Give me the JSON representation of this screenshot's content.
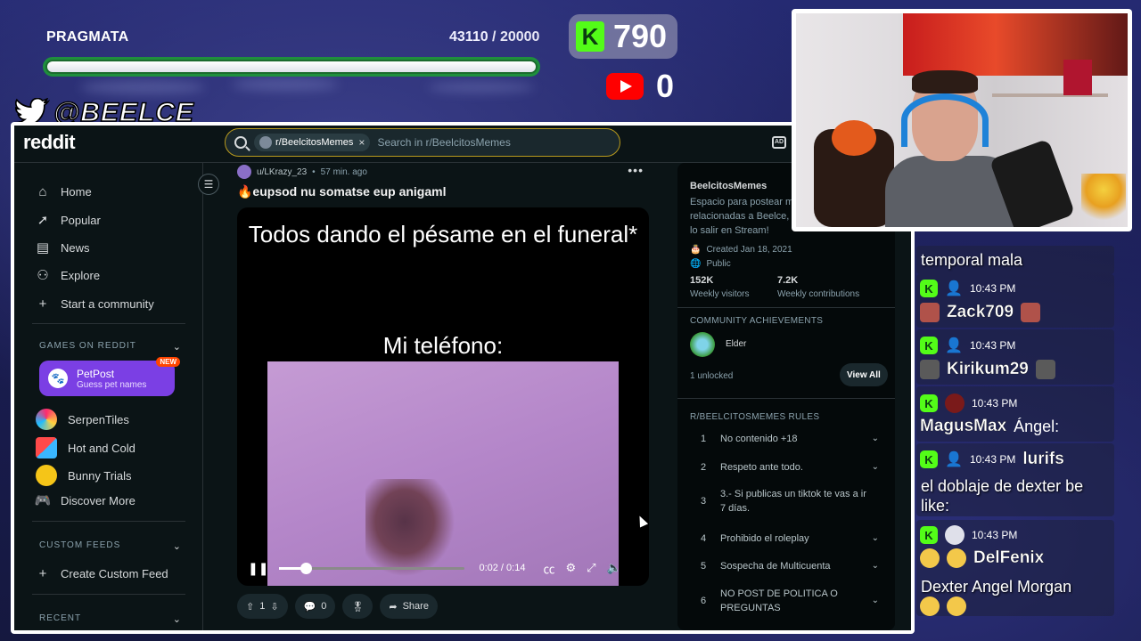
{
  "overlay": {
    "goal_title": "PRAGMATA",
    "goal_current": "43110",
    "goal_target": "20000",
    "goal_progress": 1.0,
    "kick_count": "790",
    "youtube_count": "0",
    "twitter_handle": "@BEELCE_",
    "colors": {
      "kick_green": "#53fc18",
      "youtube_red": "#ff0000",
      "goal_bar_border": "#1f8f3d"
    }
  },
  "reddit": {
    "logo": "reddit",
    "search": {
      "chip_label": "r/BeelcitosMemes",
      "chip_close": "×",
      "placeholder": "Search in r/BeelcitosMemes"
    },
    "sidebar": {
      "items": [
        {
          "label": "Home",
          "icon": "home-icon"
        },
        {
          "label": "Popular",
          "icon": "popular-icon"
        },
        {
          "label": "News",
          "icon": "news-icon"
        },
        {
          "label": "Explore",
          "icon": "explore-icon"
        },
        {
          "label": "Start a community",
          "icon": "plus-icon"
        }
      ],
      "games_header": "GAMES ON REDDIT",
      "featured_game": {
        "title": "PetPost",
        "subtitle": "Guess pet names",
        "badge": "NEW"
      },
      "games": [
        {
          "label": "SerpenTiles"
        },
        {
          "label": "Hot and Cold"
        },
        {
          "label": "Bunny Trials"
        },
        {
          "label": "Discover More"
        }
      ],
      "custom_header": "CUSTOM FEEDS",
      "create_feed": "Create Custom Feed",
      "recent_header": "RECENT"
    },
    "post": {
      "user": "u/LKrazy_23",
      "time": "57 min. ago",
      "title": "🔥eupsod nu somatse eup anigaml",
      "caption_top": "Todos dando el pésame en el funeral*",
      "caption_mid": "Mi teléfono:",
      "video_time": "0:02 / 0:14",
      "video_progress": 0.14,
      "upvotes": "1",
      "comments": "0",
      "share": "Share"
    },
    "community": {
      "name": "BeelcitosMemes",
      "description": "Espacio para postear m relacionadas a Beelce, lo salir en Stream!",
      "created": "Created Jan 18, 2021",
      "visibility": "Public",
      "visitors": "152K",
      "visitors_label": "Weekly visitors",
      "contributions": "7.2K",
      "contributions_label": "Weekly contributions",
      "achievements_header": "COMMUNITY ACHIEVEMENTS",
      "achievement": "Elder",
      "unlocked": "1 unlocked",
      "view_all": "View All",
      "rules_header": "R/BEELCITOSMEMES RULES",
      "rules": [
        {
          "n": "1",
          "text": "No contenido +18"
        },
        {
          "n": "2",
          "text": "Respeto ante todo."
        },
        {
          "n": "3",
          "text": "3.- Si publicas un tiktok te vas a ir 7 días."
        },
        {
          "n": "4",
          "text": "Prohibido el roleplay"
        },
        {
          "n": "5",
          "text": "Sospecha de Multicuenta"
        },
        {
          "n": "6",
          "text": "NO POST DE POLITICA O PREGUNTAS"
        }
      ]
    }
  },
  "chat": {
    "messages": [
      {
        "text": "temporal mala"
      },
      {
        "time": "10:43 PM",
        "name": "Zack709"
      },
      {
        "time": "10:43 PM",
        "name": "Kirikum29"
      },
      {
        "time": "10:43 PM",
        "name": "MagusMax",
        "text": "Ángel:"
      },
      {
        "time": "10:43 PM",
        "name": "lurifs",
        "text": "el doblaje de dexter be like:"
      },
      {
        "time": "10:43 PM",
        "name": "DelFenix",
        "text": "Dexter Angel Morgan"
      }
    ]
  }
}
